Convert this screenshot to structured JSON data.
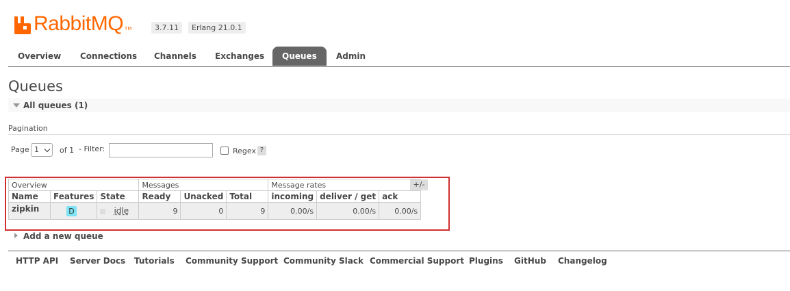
{
  "brand": {
    "name": "RabbitMQ",
    "trademark": "TM",
    "version": "3.7.11",
    "erlang": "Erlang 21.0.1",
    "color": "#ff6600"
  },
  "tabs": [
    "Overview",
    "Connections",
    "Channels",
    "Exchanges",
    "Queues",
    "Admin"
  ],
  "active_tab": "Queues",
  "page_title": "Queues",
  "all_queues_label": "All queues (1)",
  "pagination": {
    "title": "Pagination",
    "page_label": "Page",
    "page_value": "1",
    "of_label": "of 1",
    "filter_label": "- Filter:",
    "filter_value": "",
    "regex_label": "Regex",
    "help": "?"
  },
  "table": {
    "groups": [
      "Overview",
      "Messages",
      "Message rates"
    ],
    "columns": [
      "Name",
      "Features",
      "State",
      "Ready",
      "Unacked",
      "Total",
      "incoming",
      "deliver / get",
      "ack"
    ],
    "rows": [
      {
        "name": "zipkin",
        "feature": "D",
        "state": "idle",
        "ready": "9",
        "unacked": "0",
        "total": "9",
        "incoming": "0.00/s",
        "deliver_get": "0.00/s",
        "ack": "0.00/s"
      }
    ],
    "plus_minus": "+/-"
  },
  "add_queue_label": "Add a new queue",
  "footer": [
    "HTTP API",
    "Server Docs",
    "Tutorials",
    "Community Support",
    "Community Slack",
    "Commercial Support",
    "Plugins",
    "GitHub",
    "Changelog"
  ],
  "highlight_color": "#d03030"
}
